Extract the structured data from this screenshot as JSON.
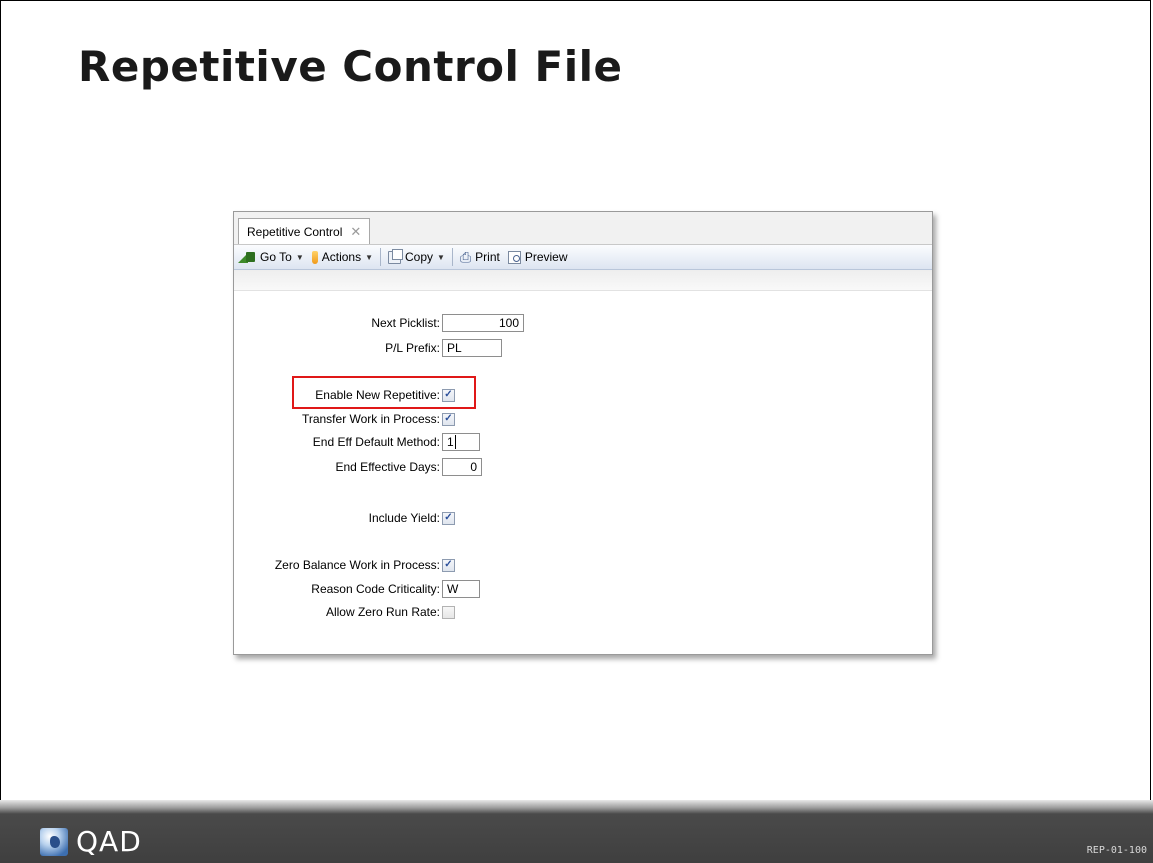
{
  "slide": {
    "title": "Repetitive Control File",
    "code": "REP-01-100"
  },
  "window": {
    "tab": {
      "label": "Repetitive Control",
      "close_glyph": "✕"
    },
    "toolbar": {
      "goto_label": "Go To",
      "actions_label": "Actions",
      "copy_label": "Copy",
      "print_label": "Print",
      "preview_label": "Preview"
    }
  },
  "form": {
    "next_picklist": {
      "label": "Next Picklist:",
      "value": "100"
    },
    "pl_prefix": {
      "label": "P/L Prefix:",
      "value": "PL"
    },
    "enable_new_repetitive": {
      "label": "Enable New Repetitive:",
      "checked": true
    },
    "transfer_wip": {
      "label": "Transfer Work in Process:",
      "checked": true
    },
    "end_eff_default_method": {
      "label": "End Eff Default Method:",
      "value": "1"
    },
    "end_effective_days": {
      "label": "End Effective Days:",
      "value": "0"
    },
    "include_yield": {
      "label": "Include Yield:",
      "checked": true
    },
    "zero_balance_wip": {
      "label": "Zero Balance Work in Process:",
      "checked": true
    },
    "reason_code_criticality": {
      "label": "Reason Code Criticality:",
      "value": "W"
    },
    "allow_zero_run_rate": {
      "label": "Allow Zero Run Rate:",
      "checked": false
    }
  },
  "footer": {
    "logo_text": "QAD"
  },
  "colors": {
    "highlight": "#e01818",
    "footer": "#3f3f3f",
    "checkmark": "#2b4f9a"
  },
  "icons": [
    "goto-icon",
    "actions-icon",
    "copy-icon",
    "print-icon",
    "preview-icon",
    "close-icon",
    "qad-logo-mark"
  ]
}
